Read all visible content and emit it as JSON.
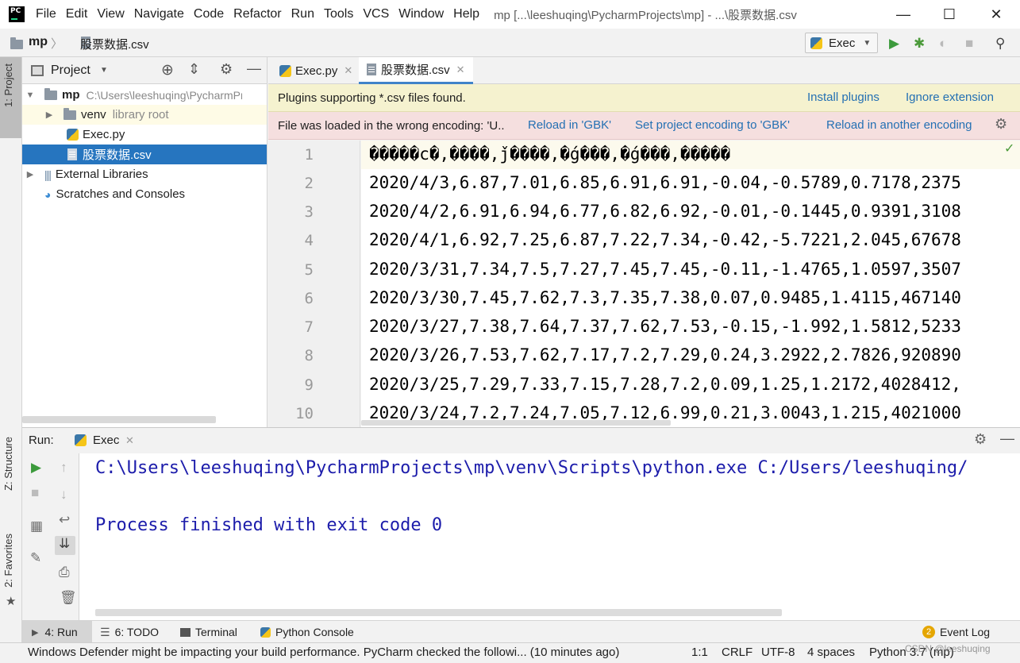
{
  "window": {
    "menu": [
      "File",
      "Edit",
      "View",
      "Navigate",
      "Code",
      "Refactor",
      "Run",
      "Tools",
      "VCS",
      "Window",
      "Help"
    ],
    "title": "mp [...\\leeshuqing\\PycharmProjects\\mp] - ...\\股票数据.csv",
    "minimize": "—",
    "maximize": "☐",
    "close": "✕"
  },
  "navbar": {
    "project": "mp",
    "file": "股票数据.csv",
    "run_config": "Exec"
  },
  "left_stripe": {
    "project_tab": "1: Project",
    "structure_tab": "Z: Structure",
    "favorites_tab": "2: Favorites"
  },
  "project_panel": {
    "title": "Project",
    "tree": [
      {
        "name": "mp",
        "hint": "C:\\Users\\leeshuqing\\PycharmPr"
      },
      {
        "name": "venv",
        "hint": "library root"
      },
      {
        "name": "Exec.py",
        "hint": ""
      },
      {
        "name": "股票数据.csv",
        "hint": ""
      },
      {
        "name": "External Libraries",
        "hint": ""
      },
      {
        "name": "Scratches and Consoles",
        "hint": ""
      }
    ]
  },
  "editor": {
    "tabs": [
      "Exec.py",
      "股票数据.csv"
    ],
    "active_tab": "股票数据.csv",
    "plugin_banner": {
      "message": "Plugins supporting *.csv files found.",
      "install": "Install plugins",
      "ignore": "Ignore extension"
    },
    "encoding_banner": {
      "message": "File was loaded in the wrong encoding: 'U..",
      "reload_gbk": "Reload in 'GBK'",
      "set_encoding": "Set project encoding to 'GBK'",
      "reload_other": "Reload in another encoding"
    },
    "line_numbers": [
      "1",
      "2",
      "3",
      "4",
      "5",
      "6",
      "7",
      "8",
      "9",
      "10"
    ],
    "lines": [
      "�����c�,����,ǰ����,�ǵ���,�ǵ���,�����",
      "2020/4/3,6.87,7.01,6.85,6.91,6.91,-0.04,-0.5789,0.7178,2375",
      "2020/4/2,6.91,6.94,6.77,6.82,6.92,-0.01,-0.1445,0.9391,3108",
      "2020/4/1,6.92,7.25,6.87,7.22,7.34,-0.42,-5.7221,2.045,67678",
      "2020/3/31,7.34,7.5,7.27,7.45,7.45,-0.11,-1.4765,1.0597,3507",
      "2020/3/30,7.45,7.62,7.3,7.35,7.38,0.07,0.9485,1.4115,467140",
      "2020/3/27,7.38,7.64,7.37,7.62,7.53,-0.15,-1.992,1.5812,5233",
      "2020/3/26,7.53,7.62,7.17,7.2,7.29,0.24,3.2922,2.7826,920890",
      "2020/3/25,7.29,7.33,7.15,7.28,7.2,0.09,1.25,1.2172,4028412,",
      "2020/3/24,7.2,7.24,7.05,7.12,6.99,0.21,3.0043,1.215,4021000"
    ]
  },
  "run_panel": {
    "label": "Run:",
    "tab": "Exec",
    "output": [
      "C:\\Users\\leeshuqing\\PycharmProjects\\mp\\venv\\Scripts\\python.exe C:/Users/leeshuqing/",
      "",
      "Process finished with exit code 0"
    ]
  },
  "tool_windows": {
    "run": "4: Run",
    "todo": "6: TODO",
    "terminal": "Terminal",
    "python_console": "Python Console",
    "event_log": "Event Log",
    "event_count": "2"
  },
  "statusbar": {
    "message": "Windows Defender might be impacting your build performance. PyCharm checked the followi... (10 minutes ago)",
    "position": "1:1",
    "line_sep": "CRLF",
    "encoding": "UTF-8",
    "indent": "4 spaces",
    "interpreter": "Python 3.7 (mp)",
    "watermark": "CSDN @leeshuqing"
  },
  "colors": {
    "selection": "#2675bf",
    "link": "#2470b3",
    "plugin_banner_bg": "#f5f2cf",
    "encoding_banner_bg": "#f5dfdf",
    "console_text": "#1c1cab",
    "run_green": "#3c9a3c"
  }
}
